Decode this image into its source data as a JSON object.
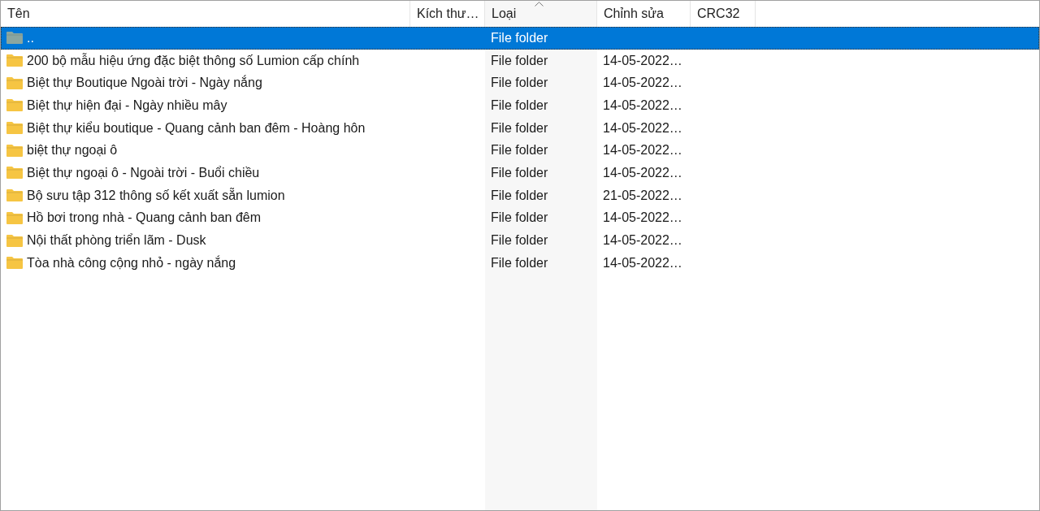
{
  "columns": [
    {
      "label": "Tên",
      "sorted": false
    },
    {
      "label": "Kích thư…",
      "sorted": false
    },
    {
      "label": "Loại",
      "sorted": true
    },
    {
      "label": "Chỉnh sửa",
      "sorted": false
    },
    {
      "label": "CRC32",
      "sorted": false
    }
  ],
  "rows": [
    {
      "kind": "parent",
      "name": "..",
      "type": "File folder",
      "modified": "",
      "selected": true
    },
    {
      "kind": "folder",
      "name": "200 bộ mẫu hiệu ứng đặc biệt thông số Lumion cấp chính",
      "type": "File folder",
      "modified": "14-05-2022…",
      "selected": false
    },
    {
      "kind": "folder",
      "name": "Biệt thự Boutique Ngoài trời - Ngày nắng",
      "type": "File folder",
      "modified": "14-05-2022…",
      "selected": false
    },
    {
      "kind": "folder",
      "name": "Biệt thự hiện đại - Ngày nhiều mây",
      "type": "File folder",
      "modified": "14-05-2022…",
      "selected": false
    },
    {
      "kind": "folder",
      "name": "Biệt thự kiểu boutique - Quang cảnh ban đêm - Hoàng hôn",
      "type": "File folder",
      "modified": "14-05-2022…",
      "selected": false
    },
    {
      "kind": "folder",
      "name": "biệt thự ngoại ô",
      "type": "File folder",
      "modified": "14-05-2022…",
      "selected": false
    },
    {
      "kind": "folder",
      "name": "Biệt thự ngoại ô - Ngoài trời - Buổi chiều",
      "type": "File folder",
      "modified": "14-05-2022…",
      "selected": false
    },
    {
      "kind": "folder",
      "name": "Bộ sưu tập 312 thông số kết xuất sẵn lumion",
      "type": "File folder",
      "modified": "21-05-2022…",
      "selected": false
    },
    {
      "kind": "folder",
      "name": "Hồ bơi trong nhà - Quang cảnh ban đêm",
      "type": "File folder",
      "modified": "14-05-2022…",
      "selected": false
    },
    {
      "kind": "folder",
      "name": "Nội thất phòng triển lãm - Dusk",
      "type": "File folder",
      "modified": "14-05-2022…",
      "selected": false
    },
    {
      "kind": "folder",
      "name": "Tòa nhà công cộng nhỏ - ngày nắng",
      "type": "File folder",
      "modified": "14-05-2022…",
      "selected": false
    }
  ]
}
